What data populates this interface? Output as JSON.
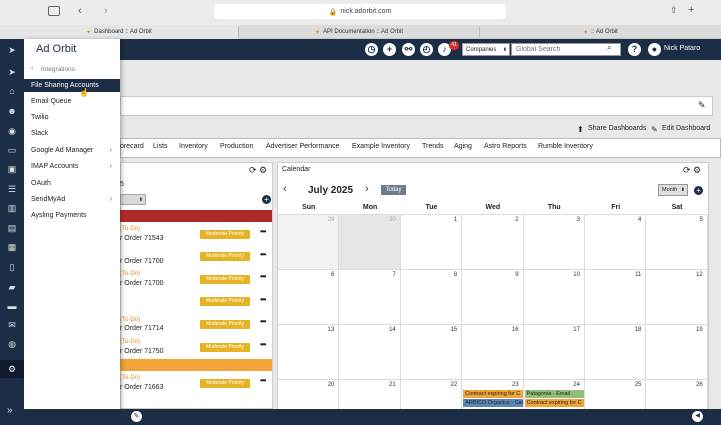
{
  "browser": {
    "url": "nick.adorbit.com",
    "tabs": [
      "Dashboard :: Ad Orbit",
      "API Documentation :: Ad Orbit",
      ":: Ad Orbit"
    ]
  },
  "header": {
    "notification_count": "41",
    "search_scope": "Companies",
    "search_placeholder": "Global Search",
    "user_name": "Nick Pataro"
  },
  "menu": {
    "logo": "Ad Orbit",
    "breadcrumb": "Integrations",
    "items": [
      {
        "label": "File Sharing Accounts",
        "submenu": false
      },
      {
        "label": "Email Queue",
        "submenu": false
      },
      {
        "label": "Twilio",
        "submenu": false
      },
      {
        "label": "Slack",
        "submenu": false
      },
      {
        "label": "Google Ad Manager",
        "submenu": true
      },
      {
        "label": "IMAP Accounts",
        "submenu": true
      },
      {
        "label": "OAuth",
        "submenu": false
      },
      {
        "label": "SendMyAd",
        "submenu": true
      },
      {
        "label": "Aysling Payments",
        "submenu": false
      }
    ]
  },
  "dashboard": {
    "share_label": "Share Dashboards",
    "edit_label": "Edit Dashboard",
    "tabs": [
      "orecard",
      "Lists",
      "Inventory",
      "Production",
      "Advertiser Performance",
      "Example Inventory",
      "Trends",
      "Aging",
      "Astro Reports",
      "Rumble Inventory"
    ]
  },
  "tasks": {
    "header_number": "5",
    "rows": [
      {
        "todo": "(To-Do)",
        "order": "r Order 71543",
        "priority": "Moderate Priority"
      },
      {
        "todo": "",
        "order": "r Order 71700",
        "priority": "Moderate Priority"
      },
      {
        "todo": "(To-Do)",
        "order": "r Order 71700",
        "priority": "Moderate Priority"
      },
      {
        "todo": "",
        "order": "",
        "priority": "Moderate Priority"
      },
      {
        "todo": "(To-Do)",
        "order": "r Order 71714",
        "priority": "Moderate Priority"
      },
      {
        "todo": "(To-Do)",
        "order": "r Order 71750",
        "priority": "Moderate Priority"
      },
      {
        "todo": "(To-Do)",
        "order": "r Order 71663",
        "priority": "Moderate Priority"
      }
    ]
  },
  "calendar": {
    "title": "Calendar",
    "month": "July 2025",
    "today_label": "Today",
    "view": "Month",
    "weekdays": [
      "Sun",
      "Mon",
      "Tue",
      "Wed",
      "Thu",
      "Fri",
      "Sat"
    ],
    "weeks": [
      [
        "29",
        "30",
        "1",
        "2",
        "3",
        "4",
        "5"
      ],
      [
        "6",
        "7",
        "8",
        "9",
        "10",
        "11",
        "12"
      ],
      [
        "13",
        "14",
        "15",
        "16",
        "17",
        "18",
        "19"
      ],
      [
        "20",
        "21",
        "22",
        "23",
        "24",
        "25",
        "26"
      ]
    ],
    "events": [
      {
        "label": "Contract expiring for C",
        "color": "#f0a43a"
      },
      {
        "label": "ARBICO Organics - Cat",
        "color": "#5a87b8"
      },
      {
        "label": "Patagonia - Email",
        "color": "#8fbf7a"
      },
      {
        "label": "Contract expiring for C",
        "color": "#f0a43a"
      }
    ]
  },
  "colors": {
    "navy": "#1c2e45",
    "red_bar": "#b02a2a",
    "orange_bar": "#f0a43a",
    "badge": "#e6b325",
    "highlight": "#1c2e45"
  }
}
